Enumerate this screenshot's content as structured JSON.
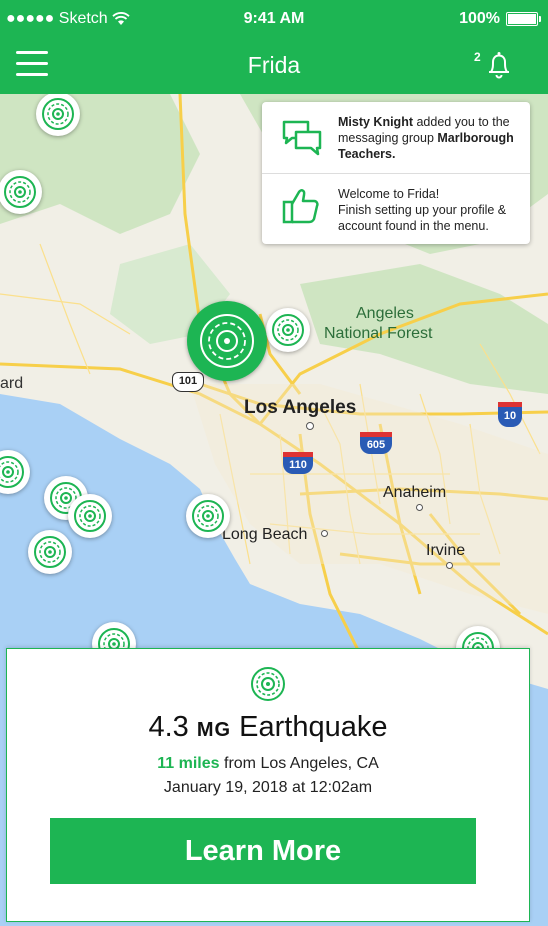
{
  "status_bar": {
    "carrier": "●●●●● Sketch",
    "time": "9:41 AM",
    "battery": "100%"
  },
  "nav": {
    "title": "Frida",
    "notification_count": "2"
  },
  "map": {
    "labels": {
      "angeles_forest_1": "Angeles",
      "angeles_forest_2": "National Forest",
      "los_angeles": "Los Angeles",
      "anaheim": "Anaheim",
      "irvine": "Irvine",
      "long_beach": "Long Beach",
      "ard": "ard"
    },
    "shields": {
      "us101": "101",
      "i10": "10",
      "i605": "605",
      "i110": "110"
    }
  },
  "notifications": [
    {
      "icon": "chat-bubbles-icon",
      "text_bold": "Misty Knight",
      "text_1": " added you to the messaging group ",
      "group_bold": "Marlborough Teachers."
    },
    {
      "icon": "thumbs-up-icon",
      "line1": "Welcome to Frida!",
      "line2": "Finish setting up your profile & account found in the menu."
    }
  ],
  "card": {
    "icon": "quake-target-icon",
    "magnitude": "4.3",
    "unit": "MG",
    "event": "Earthquake",
    "miles": "11 miles",
    "distance_text": " from Los Angeles, CA",
    "date": "January 19, 2018 at 12:02am",
    "button_label": "Learn More"
  },
  "colors": {
    "brand_green": "#1db553",
    "water": "#a9d0f5",
    "park": "#cfe5c2",
    "road": "#f7cf4a"
  }
}
